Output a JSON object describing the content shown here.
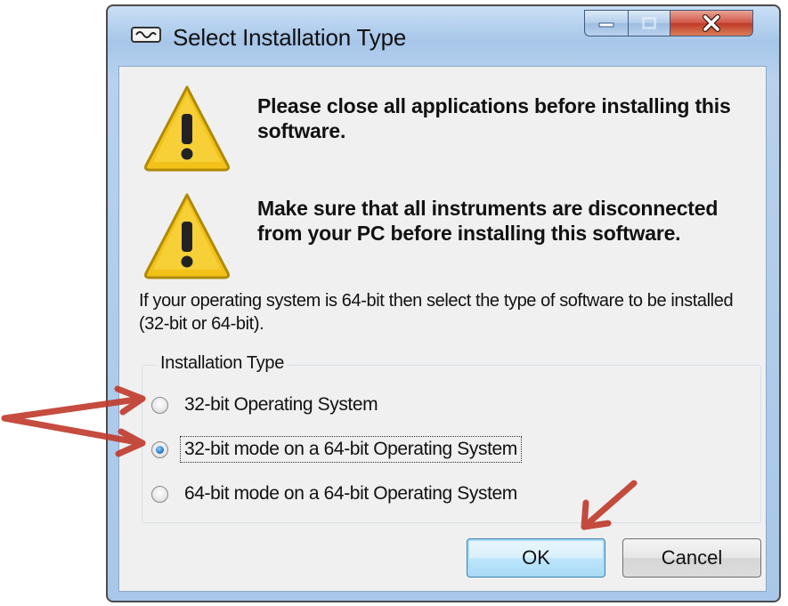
{
  "window": {
    "title": "Select Installation Type",
    "app_icon": "setup-icon",
    "caption_buttons": {
      "minimize": "minimize-icon",
      "maximize": "maximize-icon",
      "close": "close-icon"
    }
  },
  "warnings": [
    {
      "icon": "warning-icon",
      "text": "Please close all applications before installing this software."
    },
    {
      "icon": "warning-icon",
      "text": "Make sure that all instruments are disconnected from your PC before installing this software."
    }
  ],
  "info_text": "If your operating system is 64-bit then select the type of software to be installed (32-bit or 64-bit).",
  "installation_type": {
    "label": "Installation Type",
    "options": [
      {
        "label": "32-bit Operating System",
        "selected": false
      },
      {
        "label": "32-bit mode on a 64-bit Operating System",
        "selected": true
      },
      {
        "label": "64-bit mode on a 64-bit Operating System",
        "selected": false
      }
    ]
  },
  "buttons": {
    "ok": "OK",
    "cancel": "Cancel"
  },
  "annotation_color": "#c0392b"
}
